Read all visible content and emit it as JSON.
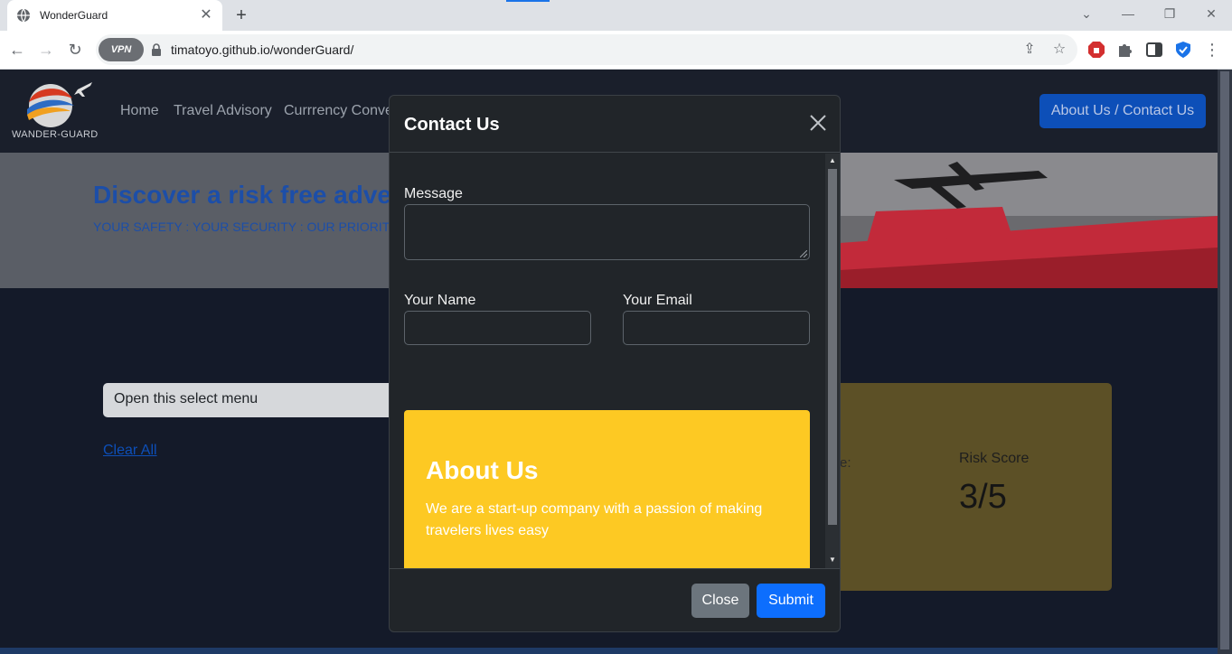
{
  "browser": {
    "tab_title": "WonderGuard",
    "tab_close": "✕",
    "new_tab": "+",
    "url": "timatoyo.github.io/wonderGuard/",
    "vpn_label": "VPN",
    "window_controls": [
      "⌄",
      "—",
      "❐",
      "✕"
    ]
  },
  "site": {
    "logo_text": "WANDER-GUARD",
    "nav": [
      "Home",
      "Travel Advisory",
      "Currrency Conve"
    ],
    "about_button": "About Us / Contact Us",
    "hero_title": "Discover a risk free advent",
    "hero_subtitle": "YOUR SAFETY : YOUR SECURITY : OUR PRIORIT",
    "select_value": "Open this select menu",
    "clear_all": "Clear All",
    "card_partial_label": "e:",
    "risk_label": "Risk Score",
    "risk_value": "3/5"
  },
  "modal": {
    "title": "Contact Us",
    "message_label": "Message",
    "name_label": "Your Name",
    "email_label": "Your Email",
    "about_title": "About Us",
    "about_text": "We are a start-up company with a passion of making travelers lives easy",
    "close_button": "Close",
    "submit_button": "Submit"
  },
  "colors": {
    "accent": "#0d6efd",
    "about_card": "#fdc923",
    "backdrop": "#141a29"
  }
}
